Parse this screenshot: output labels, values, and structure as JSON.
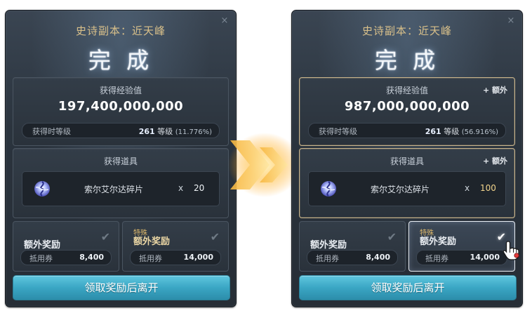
{
  "left": {
    "dungeon_title": "史诗副本：近天峰",
    "complete": "完 成",
    "exp": {
      "title": "获得经验值",
      "value": "197,400,000,000",
      "level_label": "获得时等级",
      "level_num": "261",
      "level_unit": "等级",
      "level_pct": "(11.776%)"
    },
    "items": {
      "title": "获得道具",
      "name": "索尔艾尔达碎片",
      "x": "x",
      "qty": "20"
    },
    "bonus_a": {
      "label": "额外奖励",
      "voucher_label": "抵用券",
      "voucher_value": "8,400",
      "check": "✔"
    },
    "bonus_b": {
      "special": "特殊",
      "label": "额外奖励",
      "voucher_label": "抵用券",
      "voucher_value": "14,000",
      "check": "✔"
    },
    "leave_button": "领取奖励后离开",
    "close": "×"
  },
  "right": {
    "dungeon_title": "史诗副本：近天峰",
    "complete": "完 成",
    "exp": {
      "title": "获得经验值",
      "extra": "+ 额外",
      "value": "987,000,000,000",
      "level_label": "获得时等级",
      "level_num": "261",
      "level_unit": "等级",
      "level_pct": "(56.916%)"
    },
    "items": {
      "title": "获得道具",
      "extra": "+ 额外",
      "name": "索尔艾尔达碎片",
      "x": "x",
      "qty": "100"
    },
    "bonus_a": {
      "label": "额外奖励",
      "voucher_label": "抵用券",
      "voucher_value": "8,400",
      "check": "✔"
    },
    "bonus_b": {
      "special": "特殊",
      "label": "额外奖励",
      "voucher_label": "抵用券",
      "voucher_value": "14,000",
      "check": "✔",
      "selected": true
    },
    "leave_button": "领取奖励后离开",
    "close": "×"
  },
  "icons": {
    "item": "sol-erda-fragment-icon",
    "arrow": "transition-arrow-icon",
    "cursor": "hand-cursor-icon"
  },
  "colors": {
    "panel_bg": "#2b343e",
    "title_gold": "#d9c08a",
    "button_cyan": "#3aa6c4",
    "arrow_orange": "#f4a72a",
    "gold_border": "#c8b38a"
  }
}
